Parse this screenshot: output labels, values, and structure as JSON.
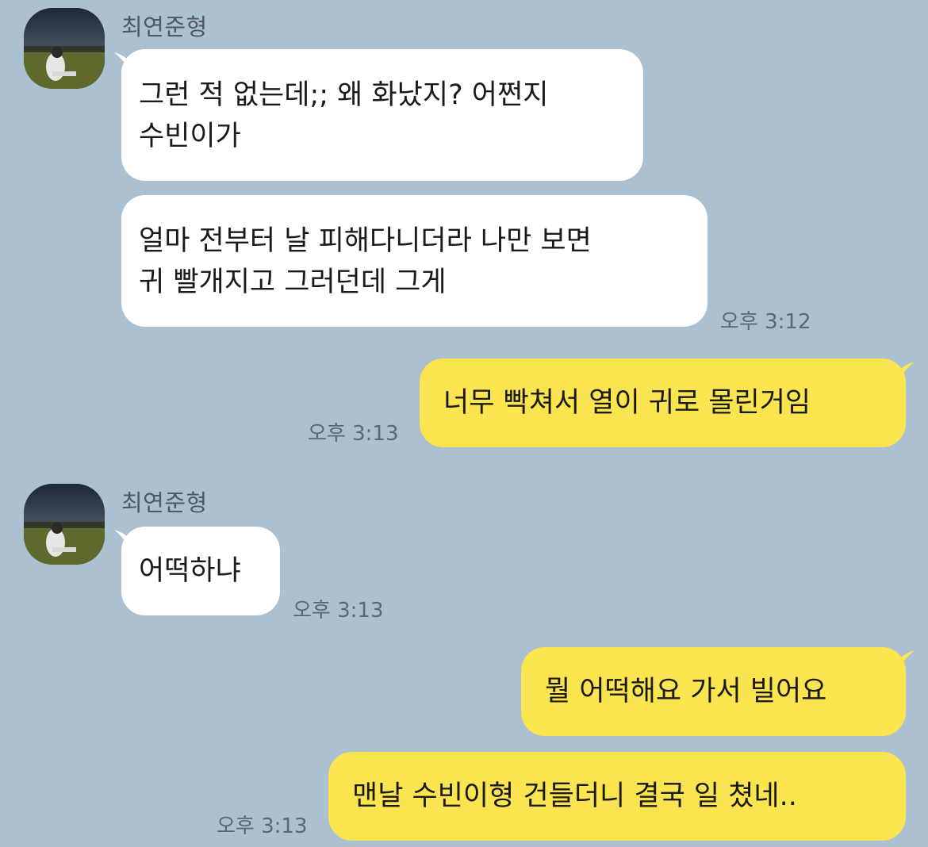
{
  "contact": {
    "name": "최연준형"
  },
  "colors": {
    "background": "#abc1d1",
    "incoming_bubble": "#ffffff",
    "outgoing_bubble": "#fae44f"
  },
  "messages": [
    {
      "from": "contact",
      "lines": [
        "그런 적 없는데;; 왜 화났지? 어쩐지",
        "수빈이가"
      ],
      "time": ""
    },
    {
      "from": "contact",
      "lines": [
        "얼마 전부터 날 피해다니더라 나만 보면",
        "귀 빨개지고 그러던데 그게"
      ],
      "time": "오후 3:12"
    },
    {
      "from": "me",
      "lines": [
        "너무 빡쳐서 열이 귀로 몰린거임"
      ],
      "time": "오후 3:13"
    },
    {
      "from": "contact",
      "lines": [
        "어떡하냐"
      ],
      "time": "오후 3:13"
    },
    {
      "from": "me",
      "lines": [
        "뭘 어떡해요 가서 빌어요"
      ],
      "time": ""
    },
    {
      "from": "me",
      "lines": [
        "맨날 수빈이형 건들더니 결국 일 쳤네.."
      ],
      "time": "오후 3:13"
    }
  ]
}
